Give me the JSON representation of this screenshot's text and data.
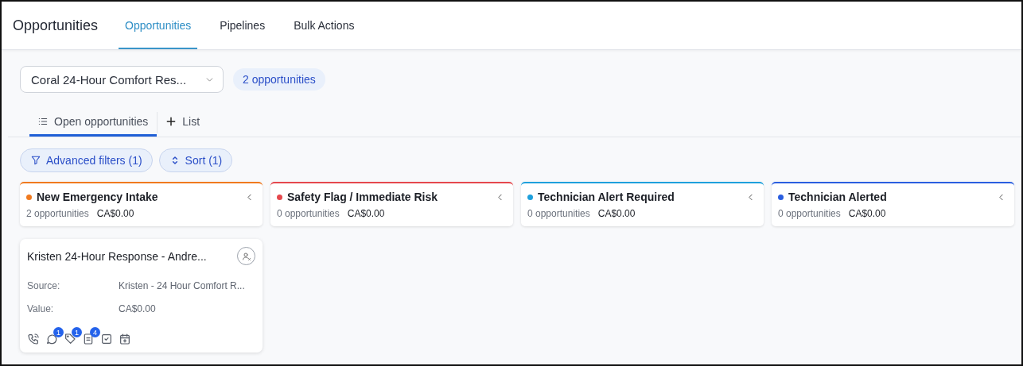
{
  "header": {
    "title": "Opportunities",
    "tabs": [
      {
        "label": "Opportunities",
        "selected": true
      },
      {
        "label": "Pipelines",
        "selected": false
      },
      {
        "label": "Bulk Actions",
        "selected": false
      }
    ]
  },
  "pipeline_select": {
    "value": "Coral 24-Hour Comfort Res..."
  },
  "count_badge": "2 opportunities",
  "view_tabs": [
    {
      "label": "Open opportunities",
      "kind": "view",
      "selected": true
    },
    {
      "label": "List",
      "kind": "add",
      "selected": false
    }
  ],
  "filters": [
    {
      "label": "Advanced filters (1)",
      "kind": "filter"
    },
    {
      "label": "Sort (1)",
      "kind": "sort"
    }
  ],
  "stages": [
    {
      "name": "New Emergency Intake",
      "color": "#f07a1f",
      "count": "2 opportunities",
      "value": "CA$0.00",
      "cards": [
        {
          "title": "Kristen 24-Hour Response - Andre...",
          "fields": [
            {
              "label": "Source:",
              "value": "Kristen - 24 Hour Comfort R..."
            },
            {
              "label": "Value:",
              "value": "CA$0.00"
            }
          ],
          "actions": [
            {
              "kind": "phone"
            },
            {
              "kind": "chat",
              "badge": "1"
            },
            {
              "kind": "tag",
              "badge": "1"
            },
            {
              "kind": "note",
              "badge": "4"
            },
            {
              "kind": "task"
            },
            {
              "kind": "calendar"
            }
          ]
        }
      ]
    },
    {
      "name": "Safety Flag / Immediate Risk",
      "color": "#e5484d",
      "count": "0 opportunities",
      "value": "CA$0.00"
    },
    {
      "name": "Technician Alert Required",
      "color": "#1ea0dc",
      "count": "0 opportunities",
      "value": "CA$0.00"
    },
    {
      "name": "Technician Alerted",
      "color": "#2a5ee0",
      "count": "0 opportunities",
      "value": "CA$0.00"
    }
  ]
}
